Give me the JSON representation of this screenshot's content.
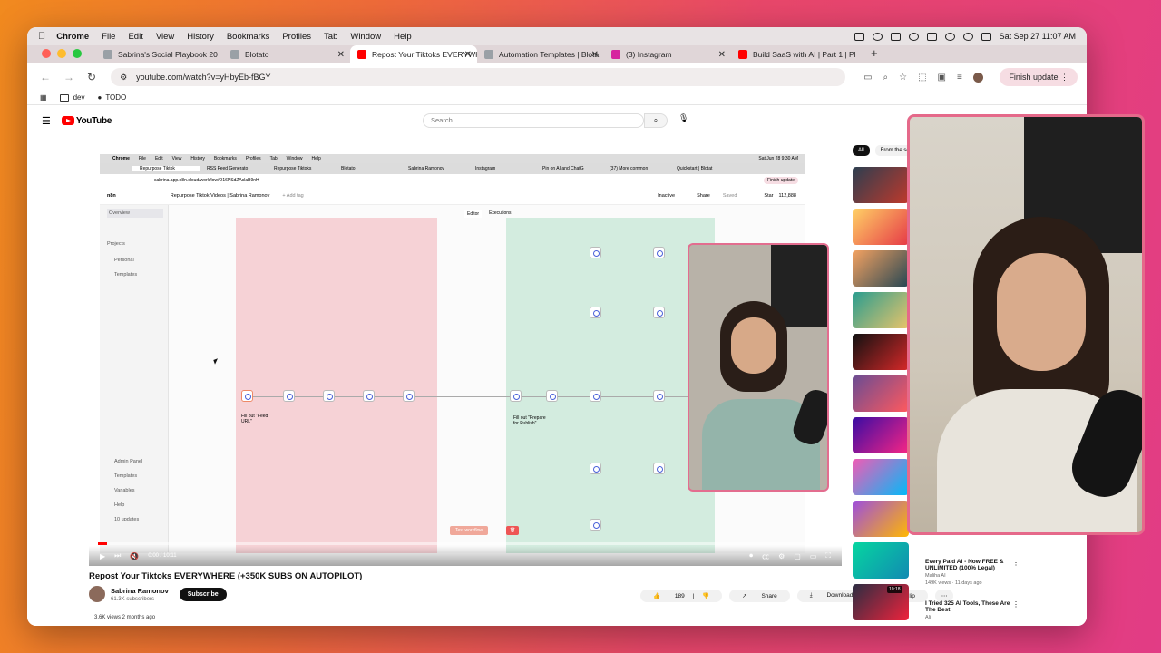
{
  "menubar": {
    "app": "Chrome",
    "items": [
      "File",
      "Edit",
      "View",
      "History",
      "Bookmarks",
      "Profiles",
      "Tab",
      "Window",
      "Help"
    ],
    "clock": "Sat Sep 27  11:07 AM"
  },
  "tabs": [
    {
      "title": "Sabrina's Social Playbook 20",
      "color": "#9aa0a6"
    },
    {
      "title": "Blotato",
      "color": "#9aa0a6"
    },
    {
      "title": "Repost Your Tiktoks EVERYWHERE",
      "color": "#ff0000"
    },
    {
      "title": "Automation Templates | Blota",
      "color": "#9aa0a6"
    },
    {
      "title": "(3) Instagram",
      "color": "#d6249f"
    },
    {
      "title": "Build SaaS with AI | Part 1 | Pl",
      "color": "#ff0000"
    }
  ],
  "address": {
    "url": "youtube.com/watch?v=yHbyEb-fBGY",
    "finish": "Finish update"
  },
  "bookmarks": [
    {
      "label": "dev"
    },
    {
      "label": "TODO"
    }
  ],
  "youtube": {
    "logo": "YouTube",
    "search_placeholder": "Search"
  },
  "inner": {
    "menubar": [
      "Chrome",
      "File",
      "Edit",
      "View",
      "History",
      "Bookmarks",
      "Profiles",
      "Tab",
      "Window",
      "Help"
    ],
    "clock": "Sat Jun 28  9:30 AM",
    "tabs": [
      "Repurpose Tiktok",
      "RSS Feed Generato",
      "Repurpose Tiktoks",
      "Blotato",
      "Sabrina Ramonov",
      "Instagram",
      "Pin on AI and ChatG",
      "(37) More common",
      "Quickstart | Blotat"
    ],
    "url": "sabrina.app.n8n.cloud/workflow/O16PSdZAslaB9nH",
    "finish": "Finish update",
    "logo": "n8n",
    "workflow_title": "Repurpose Tiktok Videos | Sabrina Ramonov",
    "add_tag": "+ Add tag",
    "editor": "Editor",
    "executions": "Executions",
    "inactive": "Inactive",
    "share": "Share",
    "saved": "Saved",
    "star": "Star",
    "stars": "112,888",
    "overview": "Overview",
    "projects": "Projects",
    "personal": "Personal",
    "templates": "Templates",
    "admin": "Admin Panel",
    "templates2": "Templates",
    "variables": "Variables",
    "help": "Help",
    "updates": "10 updates",
    "note1": "Fill out \"Feed URL\"",
    "note2": "Fill out \"Prepare for Publish\"",
    "test": "Test workflow"
  },
  "player": {
    "time": "0:00 / 10:11"
  },
  "video": {
    "title": "Repost Your Tiktoks EVERYWHERE (+350K SUBS ON AUTOPILOT)",
    "channel": "Sabrina Ramonov",
    "subs": "61.3K subscribers",
    "subscribe": "Subscribe",
    "likes": "189",
    "share": "Share",
    "download": "Download",
    "clip": "Clip",
    "meta": "3.6K views  2 months ago"
  },
  "chips": [
    "All",
    "From the seri"
  ],
  "recs": [
    {
      "title": "Every Paid AI - Now FREE & UNLIMITED (100% Legal)",
      "channel": "Maliha AI",
      "meta": "149K views · 11 days ago",
      "duration": "10:18"
    },
    {
      "title": "I Tried 325 AI Tools, These Are The Best.",
      "channel": "Ali",
      "meta": "",
      "duration": ""
    }
  ]
}
